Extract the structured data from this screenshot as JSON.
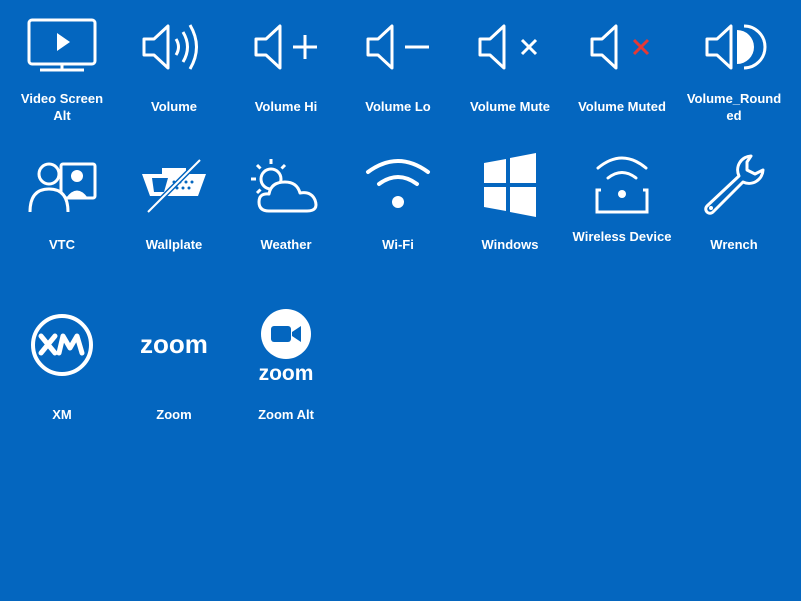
{
  "colors": {
    "background": "#0466bf",
    "icon": "#ffffff",
    "muted_x": "#e53935"
  },
  "tiles": [
    {
      "label": "Video Screen Alt",
      "icon": "video-screen-icon"
    },
    {
      "label": "Volume",
      "icon": "volume-icon"
    },
    {
      "label": "Volume Hi",
      "icon": "volume-hi-icon"
    },
    {
      "label": "Volume Lo",
      "icon": "volume-lo-icon"
    },
    {
      "label": "Volume Mute",
      "icon": "volume-mute-icon"
    },
    {
      "label": "Volume Muted",
      "icon": "volume-muted-icon"
    },
    {
      "label": "Volume_Rounded",
      "icon": "volume-rounded-icon"
    },
    {
      "label": "VTC",
      "icon": "vtc-icon"
    },
    {
      "label": "Wallplate",
      "icon": "wallplate-icon"
    },
    {
      "label": "Weather",
      "icon": "weather-icon"
    },
    {
      "label": "Wi-Fi",
      "icon": "wifi-icon"
    },
    {
      "label": "Windows",
      "icon": "windows-icon"
    },
    {
      "label": "Wireless Device",
      "icon": "wireless-device-icon"
    },
    {
      "label": "Wrench",
      "icon": "wrench-icon"
    },
    {
      "label": "XM",
      "icon": "xm-icon"
    },
    {
      "label": "Zoom",
      "icon": "zoom-icon"
    },
    {
      "label": "Zoom Alt",
      "icon": "zoom-alt-icon"
    }
  ]
}
